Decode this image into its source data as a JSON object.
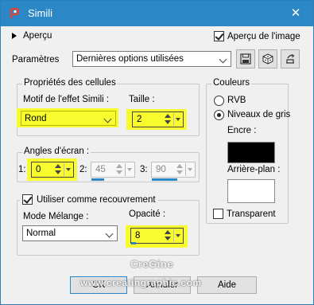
{
  "window": {
    "title": "Simili",
    "close_glyph": "✕"
  },
  "preview": {
    "label": "Aperçu",
    "image_label": "Aperçu de l'image",
    "image_checked": true
  },
  "params": {
    "label": "Paramètres",
    "preset_value": "Dernières options utilisées"
  },
  "icons": {
    "app": "paintshop-icon",
    "save": "save-preset-icon",
    "dice": "randomize-icon",
    "reset": "reset-icon"
  },
  "cells": {
    "title": "Propriétés des cellules",
    "pattern_label": "Motif de l'effet Simili :",
    "pattern_value": "Rond",
    "size_label": "Taille :",
    "size_value": "2"
  },
  "angles": {
    "title": "Angles d'écran :",
    "a1_label": "1:",
    "a1_value": "0",
    "a2_label": "2:",
    "a2_value": "45",
    "a3_label": "3:",
    "a3_value": "90"
  },
  "overlay": {
    "checkbox_label": "Utiliser comme recouvrement",
    "checked": true,
    "blend_label": "Mode Mélange :",
    "blend_value": "Normal",
    "opacity_label": "Opacité :",
    "opacity_value": "8"
  },
  "colors": {
    "title": "Couleurs",
    "rgb_label": "RVB",
    "gray_label": "Niveaux de gris",
    "selected": "gray",
    "ink_label": "Encre :",
    "ink_color": "#000000",
    "bg_label": "Arrière-plan :",
    "bg_color": "#ffffff",
    "transparent_label": "Transparent",
    "transparent_checked": false
  },
  "buttons": {
    "ok": "OK",
    "cancel": "Annuler",
    "help": "Aide"
  },
  "watermark": {
    "line1": "CreGine",
    "line2": "www.creatingraphic.com"
  },
  "accent": "#2c87c7",
  "highlight": "#f8fc2e"
}
